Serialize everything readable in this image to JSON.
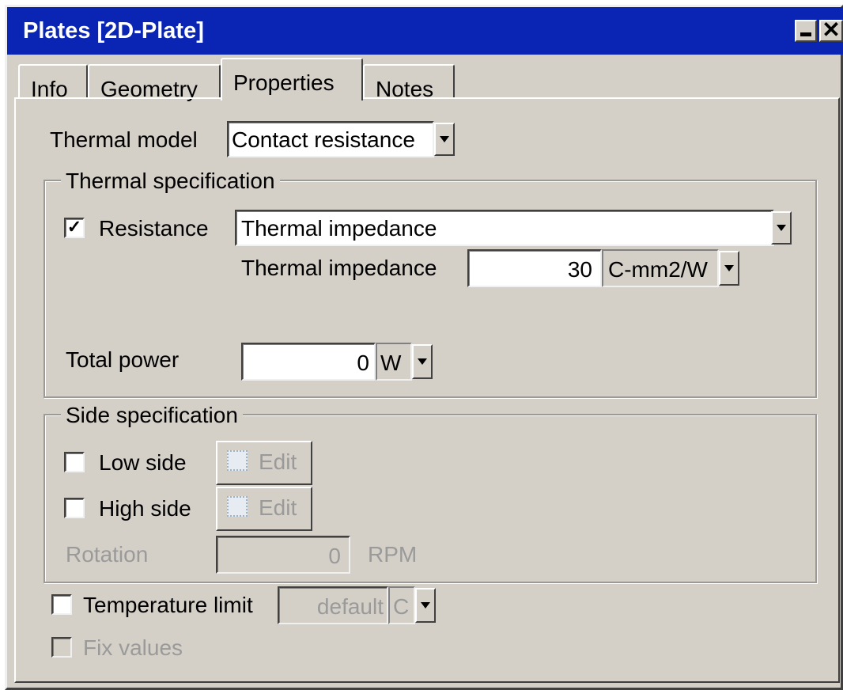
{
  "window": {
    "title": "Plates [2D-Plate]",
    "minimize_icon": "minimize-icon",
    "close_label": "✕"
  },
  "tabs": [
    {
      "label": "Info",
      "active": false
    },
    {
      "label": "Geometry",
      "active": false
    },
    {
      "label": "Properties",
      "active": true
    },
    {
      "label": "Notes",
      "active": false
    }
  ],
  "thermal_model": {
    "label": "Thermal model",
    "value": "Contact resistance"
  },
  "thermal_spec": {
    "legend": "Thermal specification",
    "resistance": {
      "label": "Resistance",
      "checked": true,
      "check_mark": "✓",
      "value": "Thermal impedance"
    },
    "impedance": {
      "label": "Thermal impedance",
      "value": "30",
      "unit": "C-mm2/W"
    },
    "total_power": {
      "label": "Total power",
      "value": "0",
      "unit": "W"
    }
  },
  "side_spec": {
    "legend": "Side specification",
    "low_side": {
      "label": "Low side",
      "checked": false,
      "edit_label": "Edit"
    },
    "high_side": {
      "label": "High side",
      "checked": false,
      "edit_label": "Edit"
    },
    "rotation": {
      "label": "Rotation",
      "value": "0",
      "unit": "RPM"
    }
  },
  "temperature_limit": {
    "label": "Temperature limit",
    "checked": false,
    "value": "default",
    "unit": "C"
  },
  "fix_values": {
    "label": "Fix values",
    "checked": false
  },
  "colors": {
    "titlebar": "#0a24b4",
    "face": "#d4d0c8",
    "disabled_text": "#9a9a9a"
  }
}
